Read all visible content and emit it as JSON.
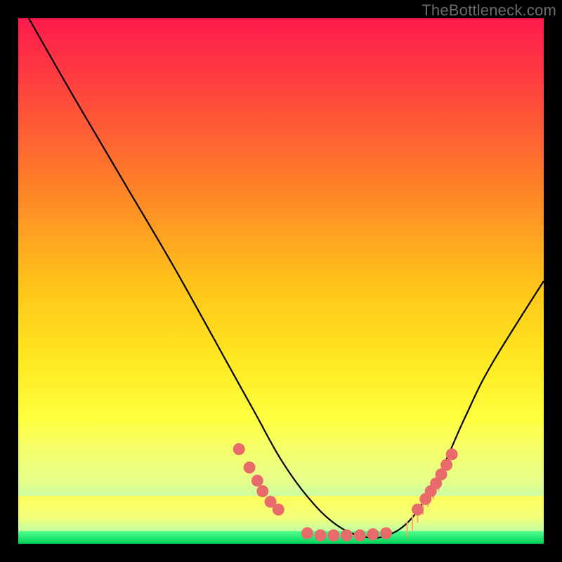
{
  "watermark": "TheBottleneck.com",
  "chart_data": {
    "type": "line",
    "title": "",
    "xlabel": "",
    "ylabel": "",
    "x_range": [
      0,
      100
    ],
    "y_range": [
      0,
      100
    ],
    "series": [
      {
        "name": "curve",
        "x": [
          2,
          10,
          20,
          30,
          40,
          45,
          50,
          55,
          60,
          65,
          70,
          75,
          80,
          85,
          90,
          100
        ],
        "y": [
          100,
          86,
          69,
          52,
          34,
          25,
          16,
          9,
          4,
          1.5,
          1.5,
          5,
          13,
          24,
          34,
          50
        ]
      }
    ],
    "markers_left": {
      "name": "left-cluster",
      "color": "#e96a6a",
      "x": [
        42,
        44,
        45.5,
        46.5,
        48,
        49.5
      ],
      "y": [
        18,
        14.5,
        12,
        10,
        8,
        6.5
      ]
    },
    "markers_bottom": {
      "name": "bottom-cluster",
      "color": "#e96a6a",
      "x": [
        55,
        57.5,
        60,
        62.5,
        65,
        67.5,
        70
      ],
      "y": [
        2,
        1.6,
        1.6,
        1.6,
        1.6,
        1.8,
        2
      ]
    },
    "markers_right": {
      "name": "right-cluster",
      "color": "#e96a6a",
      "x": [
        76,
        77.5,
        78.5,
        79.5,
        80.5,
        81.5,
        82.5
      ],
      "y": [
        6.5,
        8.5,
        10,
        11.5,
        13.2,
        15,
        17
      ]
    },
    "ticks_right": {
      "name": "orange-ticks",
      "color": "#ffb060",
      "x": [
        74,
        75,
        76,
        77,
        78,
        79,
        80
      ],
      "y_top": [
        4.3,
        5.5,
        7,
        8.5,
        10,
        11.5,
        13
      ],
      "length": 3
    },
    "colors": {
      "curve": "#000000",
      "marker": "#e96a6a",
      "tick": "#f7a965"
    }
  }
}
